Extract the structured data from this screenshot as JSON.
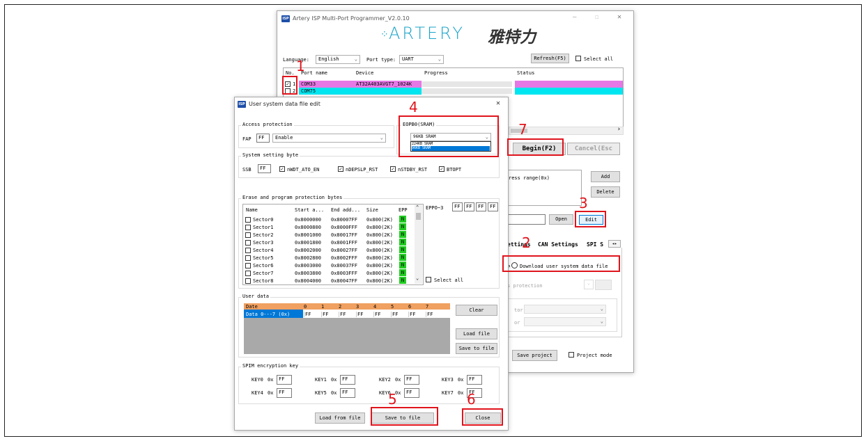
{
  "main_window": {
    "title": "Artery ISP Multi-Port Programmer_V2.0.10",
    "logo_latin": "ARTERY",
    "logo_cn": "雅特力",
    "language_label": "Language:",
    "language_value": "English",
    "port_type_label": "Port type:",
    "port_type_value": "UART",
    "refresh_button": "Refresh(F5)",
    "select_all_label": "Select all",
    "columns": [
      "No.",
      "Port name",
      "Device",
      "Progress",
      "Status"
    ],
    "rows": [
      {
        "no": "1",
        "port": "COM33",
        "device": "AT32A403AVGT7_1024K",
        "checked": true,
        "color": "#e678e6"
      },
      {
        "no": "2",
        "port": "COM75",
        "device": "",
        "checked": false,
        "color": "#00e6f0"
      }
    ],
    "begin_button": "Begin(F2)",
    "cancel_button": "Cancel(Esc",
    "address_range_label": "ress range(0x)",
    "add_button": "Add",
    "delete_button": "Delete",
    "open_button": "Open",
    "edit_button": "Edit",
    "tabs": [
      "ettings",
      "CAN Settings",
      "SPI S"
    ],
    "download_radio": "Download user system data file",
    "fap_partial": "P",
    "access_protection_partial": "s protection",
    "ector_partial": "tor",
    "or_partial": "or",
    "save_project_button": "Save project",
    "project_mode_label": "Project mode"
  },
  "dialog": {
    "title": "User system data file edit",
    "access_protection_group": "Access protection",
    "fap_label": "FAP",
    "fap_value": "FF",
    "fap_select": "Enable",
    "eopb0_group": "EOPB0(SRAM)",
    "eopb0_value": "96KB SRAM",
    "eopb0_options": [
      "224KB SRAM",
      "96KB SRAM"
    ],
    "ssb_group": "System setting byte",
    "ssb_label": "SSB",
    "ssb_value": "FF",
    "ssb_checks": [
      "nWDT_ATO_EN",
      "nDEPSLP_RST",
      "nSTDBY_RST",
      "BTOPT"
    ],
    "erase_group": "Erase and program protection bytes",
    "sector_columns": [
      "Name",
      "Start a...",
      "End add...",
      "Size",
      "EPP"
    ],
    "sectors": [
      {
        "name": "Sector0",
        "start": "0x8000000",
        "end": "0x80007FF",
        "size": "0x800(2K)",
        "epp": "N"
      },
      {
        "name": "Sector1",
        "start": "0x8000800",
        "end": "0x8000FFF",
        "size": "0x800(2K)",
        "epp": "N"
      },
      {
        "name": "Sector2",
        "start": "0x8001000",
        "end": "0x80017FF",
        "size": "0x800(2K)",
        "epp": "N"
      },
      {
        "name": "Sector3",
        "start": "0x8001800",
        "end": "0x8001FFF",
        "size": "0x800(2K)",
        "epp": "N"
      },
      {
        "name": "Sector4",
        "start": "0x8002000",
        "end": "0x80027FF",
        "size": "0x800(2K)",
        "epp": "N"
      },
      {
        "name": "Sector5",
        "start": "0x8002800",
        "end": "0x8002FFF",
        "size": "0x800(2K)",
        "epp": "N"
      },
      {
        "name": "Sector6",
        "start": "0x8003000",
        "end": "0x80037FF",
        "size": "0x800(2K)",
        "epp": "N"
      },
      {
        "name": "Sector7",
        "start": "0x8003800",
        "end": "0x8003FFF",
        "size": "0x800(2K)",
        "epp": "N"
      },
      {
        "name": "Sector8",
        "start": "0x8004000",
        "end": "0x80047FF",
        "size": "0x800(2K)",
        "epp": "N"
      }
    ],
    "eppo_label": "EPPO~3",
    "eppo_values": [
      "FF",
      "FF",
      "FF",
      "FF"
    ],
    "select_all_label": "Select all",
    "user_data_group": "User data",
    "ud_columns": [
      "Date",
      "0",
      "1",
      "2",
      "3",
      "4",
      "5",
      "6",
      "7"
    ],
    "ud_row_label": "Data 0---7 (0x)",
    "ud_values": [
      "FF",
      "FF",
      "FF",
      "FF",
      "FF",
      "FF",
      "FF",
      "FF"
    ],
    "clear_button": "Clear",
    "load_file_button": "Load file",
    "save_to_file_button_side": "Save to file",
    "spim_group": "SPIM encryption key",
    "keys": [
      {
        "label": "KEY0",
        "prefix": "0x",
        "value": "FF"
      },
      {
        "label": "KEY1",
        "prefix": "0x",
        "value": "FF"
      },
      {
        "label": "KEY2",
        "prefix": "0x",
        "value": "FF"
      },
      {
        "label": "KEY3",
        "prefix": "0x",
        "value": "FF"
      },
      {
        "label": "KEY4",
        "prefix": "0x",
        "value": "FF"
      },
      {
        "label": "KEY5",
        "prefix": "0x",
        "value": "FF"
      },
      {
        "label": "KEY6",
        "prefix": "0x",
        "value": "FF"
      },
      {
        "label": "KEY7",
        "prefix": "0x",
        "value": "FF"
      }
    ],
    "load_from_file_button": "Load from file",
    "save_to_file_button": "Save to file",
    "close_button": "Close"
  },
  "annotations": [
    "1",
    "2",
    "3",
    "4",
    "5",
    "6",
    "7"
  ],
  "colors": {
    "annotation_red": "#e0141c",
    "row1_magenta": "#e678e6",
    "row2_cyan": "#00e6f0",
    "user_data_header": "#f0a060",
    "epp_green": "#22cc22",
    "selection_blue": "#0078d7"
  }
}
